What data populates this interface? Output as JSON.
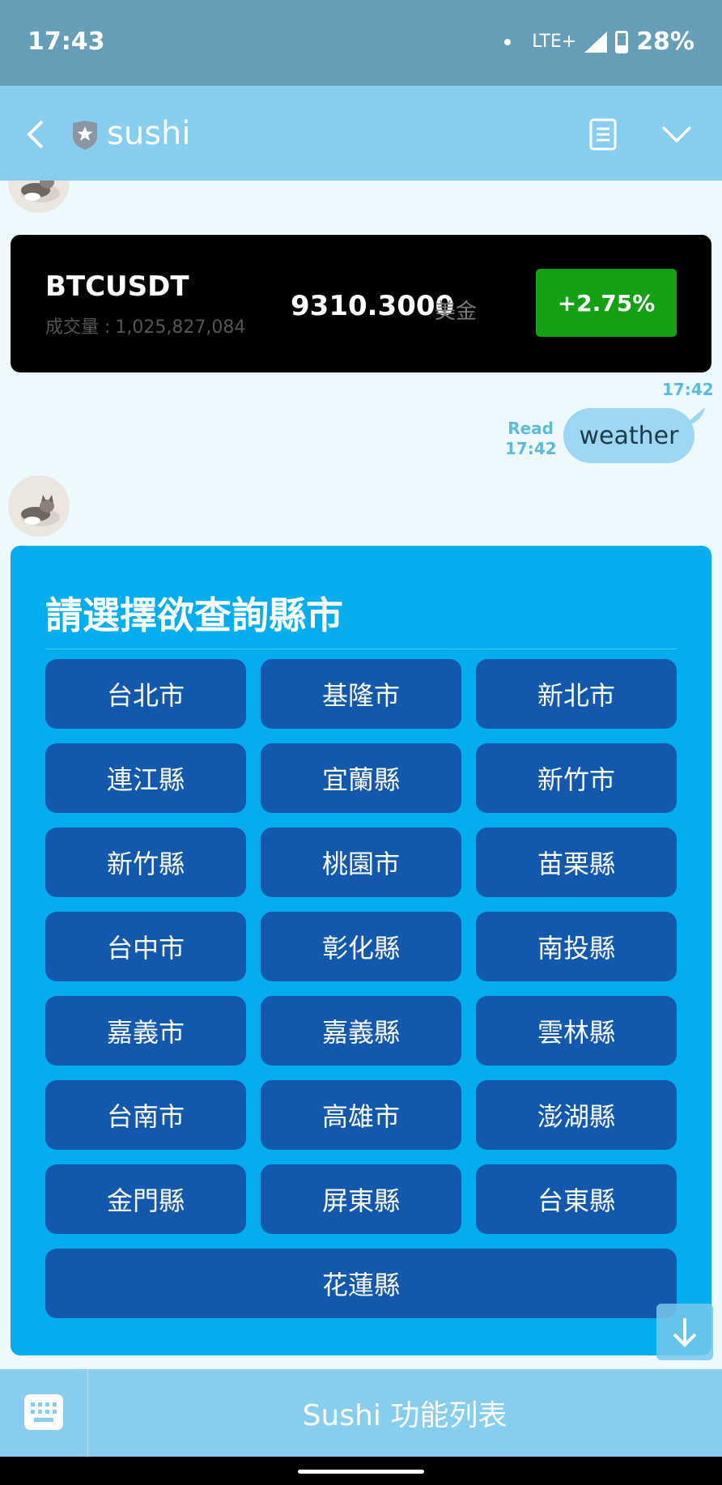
{
  "status_bar": {
    "time": "17:43",
    "network": "LTE+",
    "battery": "28%",
    "battery_level": 0.28
  },
  "header": {
    "title": "sushi"
  },
  "messages": {
    "stock": {
      "symbol": "BTCUSDT",
      "volume_label": "成交量 :",
      "volume": "1,025,827,084",
      "price": "9310.3000",
      "currency": "美金",
      "change": "+2.75%",
      "timestamp": "17:42"
    },
    "outgoing": {
      "text": "weather",
      "read": "Read",
      "time": "17:42"
    },
    "city_menu": {
      "title": "請選擇欲查詢縣市",
      "cities": [
        "台北市",
        "基隆市",
        "新北市",
        "連江縣",
        "宜蘭縣",
        "新竹市",
        "新竹縣",
        "桃園市",
        "苗栗縣",
        "台中市",
        "彰化縣",
        "南投縣",
        "嘉義市",
        "嘉義縣",
        "雲林縣",
        "台南市",
        "高雄市",
        "澎湖縣",
        "金門縣",
        "屏東縣",
        "台東縣",
        "花蓮縣"
      ]
    }
  },
  "bottom_bar": {
    "menu_label": "Sushi 功能列表"
  },
  "colors": {
    "header": "#87cdee",
    "card": "#04aeee",
    "button": "#1259ae",
    "up": "#13a113"
  }
}
